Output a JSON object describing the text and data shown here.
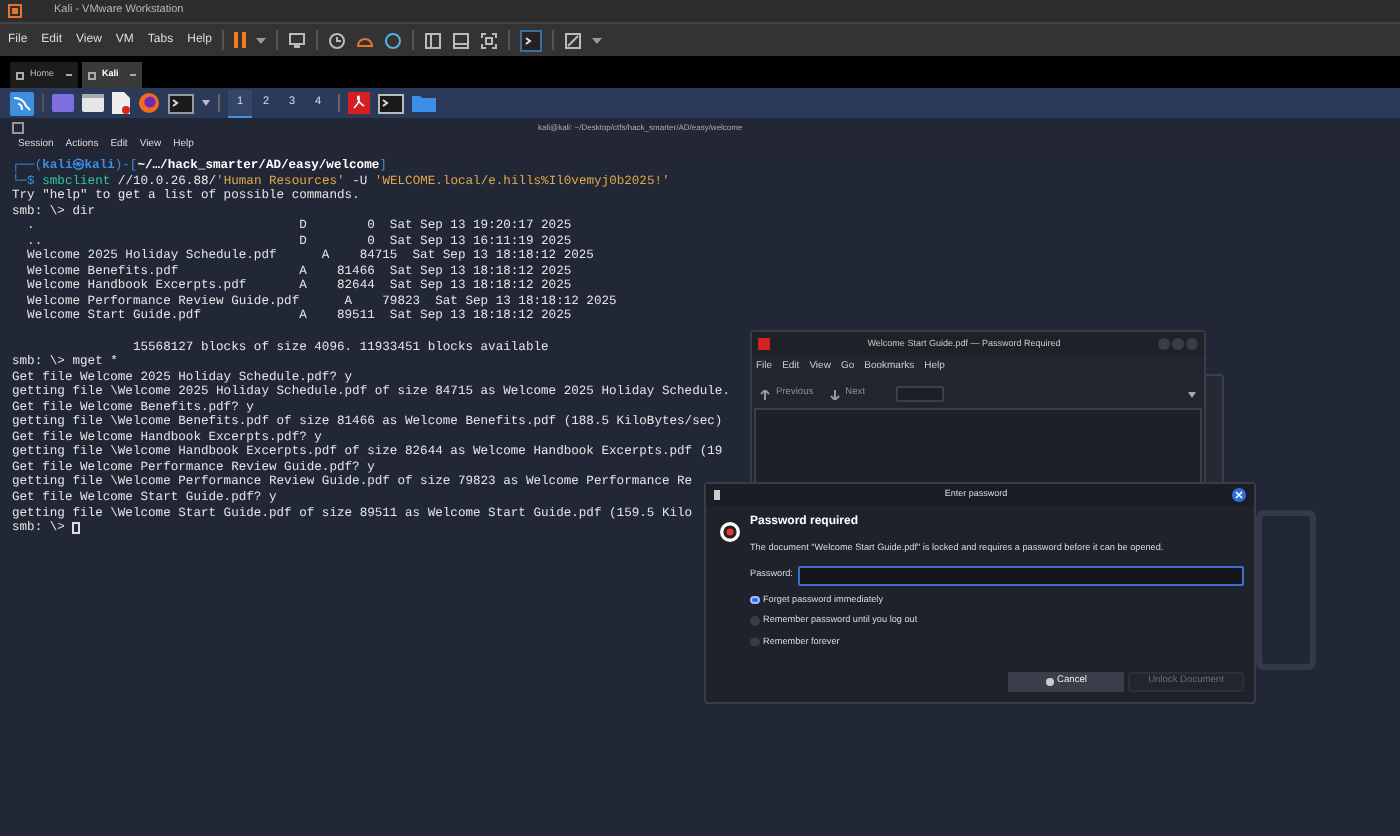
{
  "window": {
    "title": "Kali - VMware Workstation"
  },
  "menu": [
    "File",
    "Edit",
    "View",
    "VM",
    "Tabs",
    "Help"
  ],
  "tabs": [
    {
      "label": "Home",
      "selected": false
    },
    {
      "label": "Kali",
      "selected": true
    }
  ],
  "workspaces": [
    {
      "label": "1",
      "selected": true
    },
    {
      "label": "2",
      "selected": false
    },
    {
      "label": "3",
      "selected": false
    },
    {
      "label": "4",
      "selected": false
    }
  ],
  "terminal": {
    "title": "kali@kali: ~/Desktop/ctfs/hack_smarter/AD/easy/welcome",
    "menu": [
      "Session",
      "Actions",
      "Edit",
      "View",
      "Help"
    ],
    "lines": [
      {
        "kind": "segments",
        "parts": [
          {
            "kind": "frame",
            "text": "┌──("
          },
          {
            "kind": "user",
            "text": "kali㉿kali"
          },
          {
            "kind": "frame",
            "text": ")-["
          },
          {
            "kind": "path",
            "text": "~/…/hack_smarter/AD/easy/welcome"
          },
          {
            "kind": "frame",
            "text": "]"
          }
        ]
      },
      {
        "kind": "segments",
        "parts": [
          {
            "kind": "frame",
            "text": "└─$ "
          },
          {
            "kind": "program",
            "text": "smbclient"
          },
          {
            "kind": "plain",
            "text": " //10.0.26.88/"
          },
          {
            "kind": "string",
            "text": "'Human Resources'"
          },
          {
            "kind": "flag",
            "text": " -U "
          },
          {
            "kind": "string",
            "text": "'WELCOME.local/e.hills%Il0vemyj0b2025!'"
          }
        ]
      },
      {
        "kind": "text",
        "text": "Try \"help\" to get a list of possible commands."
      },
      {
        "kind": "text",
        "text": "smb: \\> dir"
      },
      {
        "kind": "text",
        "text": "  .                                   D        0  Sat Sep 13 19:20:17 2025"
      },
      {
        "kind": "text",
        "text": "  ..                                  D        0  Sat Sep 13 16:11:19 2025"
      },
      {
        "kind": "text",
        "text": "  Welcome 2025 Holiday Schedule.pdf      A    84715  Sat Sep 13 18:18:12 2025"
      },
      {
        "kind": "text",
        "text": "  Welcome Benefits.pdf                A    81466  Sat Sep 13 18:18:12 2025"
      },
      {
        "kind": "text",
        "text": "  Welcome Handbook Excerpts.pdf       A    82644  Sat Sep 13 18:18:12 2025"
      },
      {
        "kind": "text",
        "text": "  Welcome Performance Review Guide.pdf      A    79823  Sat Sep 13 18:18:12 2025"
      },
      {
        "kind": "text",
        "text": "  Welcome Start Guide.pdf             A    89511  Sat Sep 13 18:18:12 2025"
      },
      {
        "kind": "blank"
      },
      {
        "kind": "text",
        "text": "                15568127 blocks of size 4096. 11933451 blocks available"
      },
      {
        "kind": "text",
        "text": "smb: \\> mget *"
      },
      {
        "kind": "text",
        "text": "Get file Welcome 2025 Holiday Schedule.pdf? y"
      },
      {
        "kind": "text",
        "text": "getting file \\Welcome 2025 Holiday Schedule.pdf of size 84715 as Welcome 2025 Holiday Schedule."
      },
      {
        "kind": "text",
        "text": "Get file Welcome Benefits.pdf? y"
      },
      {
        "kind": "text",
        "text": "getting file \\Welcome Benefits.pdf of size 81466 as Welcome Benefits.pdf (188.5 KiloBytes/sec)"
      },
      {
        "kind": "text",
        "text": "Get file Welcome Handbook Excerpts.pdf? y"
      },
      {
        "kind": "text",
        "text": "getting file \\Welcome Handbook Excerpts.pdf of size 82644 as Welcome Handbook Excerpts.pdf (19"
      },
      {
        "kind": "text",
        "text": "Get file Welcome Performance Review Guide.pdf? y"
      },
      {
        "kind": "text",
        "text": "getting file \\Welcome Performance Review Guide.pdf of size 79823 as Welcome Performance Re"
      },
      {
        "kind": "text",
        "text": "Get file Welcome Start Guide.pdf? y"
      },
      {
        "kind": "text",
        "text": "getting file \\Welcome Start Guide.pdf of size 89511 as Welcome Start Guide.pdf (159.5 Kilo"
      },
      {
        "kind": "cursor",
        "text": "smb: \\> "
      }
    ]
  },
  "pdf_window": {
    "title": "Welcome Start Guide.pdf — Password Required",
    "menu": [
      "File",
      "Edit",
      "View",
      "Go",
      "Bookmarks",
      "Help"
    ],
    "toolbar": [
      {
        "label": "Previous",
        "disabled": true
      },
      {
        "label": "Next",
        "disabled": true
      }
    ]
  },
  "dialog": {
    "title": "Enter password",
    "heading": "Password required",
    "message": "The document \"Welcome Start Guide.pdf\" is locked and requires a password before it can be opened.",
    "field_label": "Password:",
    "options": [
      {
        "label": "Forget password immediately",
        "selected": true
      },
      {
        "label": "Remember password until you log out",
        "selected": false
      },
      {
        "label": "Remember forever",
        "selected": false
      }
    ],
    "buttons": [
      {
        "label": "Cancel",
        "disabled": false
      },
      {
        "label": "Unlock Document",
        "disabled": true
      }
    ]
  }
}
